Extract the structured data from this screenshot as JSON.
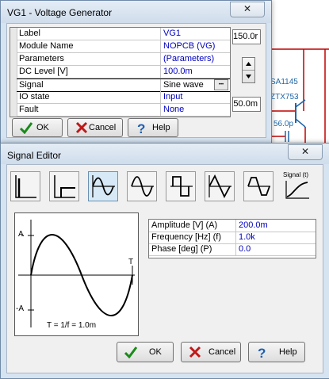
{
  "background": {
    "component_label": "SA1145",
    "transistor_label": "ZTX753",
    "cap_label": "56.0p",
    "left_value": "150.r"
  },
  "vg_window": {
    "title": "VG1 - Voltage Generator",
    "close_glyph": "✕",
    "rows": [
      {
        "label": "Label",
        "value": "VG1"
      },
      {
        "label": "Module Name",
        "value": "NOPCB (VG)"
      },
      {
        "label": "Parameters",
        "value": "(Parameters)"
      },
      {
        "label": "DC Level [V]",
        "value": "100.0m"
      },
      {
        "label": "Signal",
        "value": "Sine wave"
      },
      {
        "label": "IO state",
        "value": "Input"
      },
      {
        "label": "Fault",
        "value": "None"
      }
    ],
    "ellipsis": "•••",
    "top_value": "150.0r",
    "bottom_value": "50.0m",
    "ok_label": "OK",
    "cancel_label": "Cancel",
    "help_label": "Help"
  },
  "signal_editor": {
    "title": "Signal Editor",
    "close_glyph": "✕",
    "toolbar_items": [
      "unit-step",
      "step-delay",
      "sine-damped",
      "sine",
      "square",
      "triangle",
      "trapezoid",
      "custom"
    ],
    "custom_label": "Signal (t)",
    "preview": {
      "a_plus": "A",
      "a_minus": "-A",
      "t_label": "T",
      "formula": "T = 1/f = 1.0m"
    },
    "params": [
      {
        "label": "Amplitude [V] (A)",
        "value": "200.0m"
      },
      {
        "label": "Frequency [Hz] (f)",
        "value": "1.0k"
      },
      {
        "label": "Phase [deg] (P)",
        "value": "0.0"
      }
    ],
    "ok_label": "OK",
    "cancel_label": "Cancel",
    "help_label": "Help"
  },
  "colors": {
    "value_blue": "#0000c0",
    "ok_green": "#1a8a1a",
    "cancel_red": "#c01818",
    "help_blue": "#1f5fb0"
  }
}
